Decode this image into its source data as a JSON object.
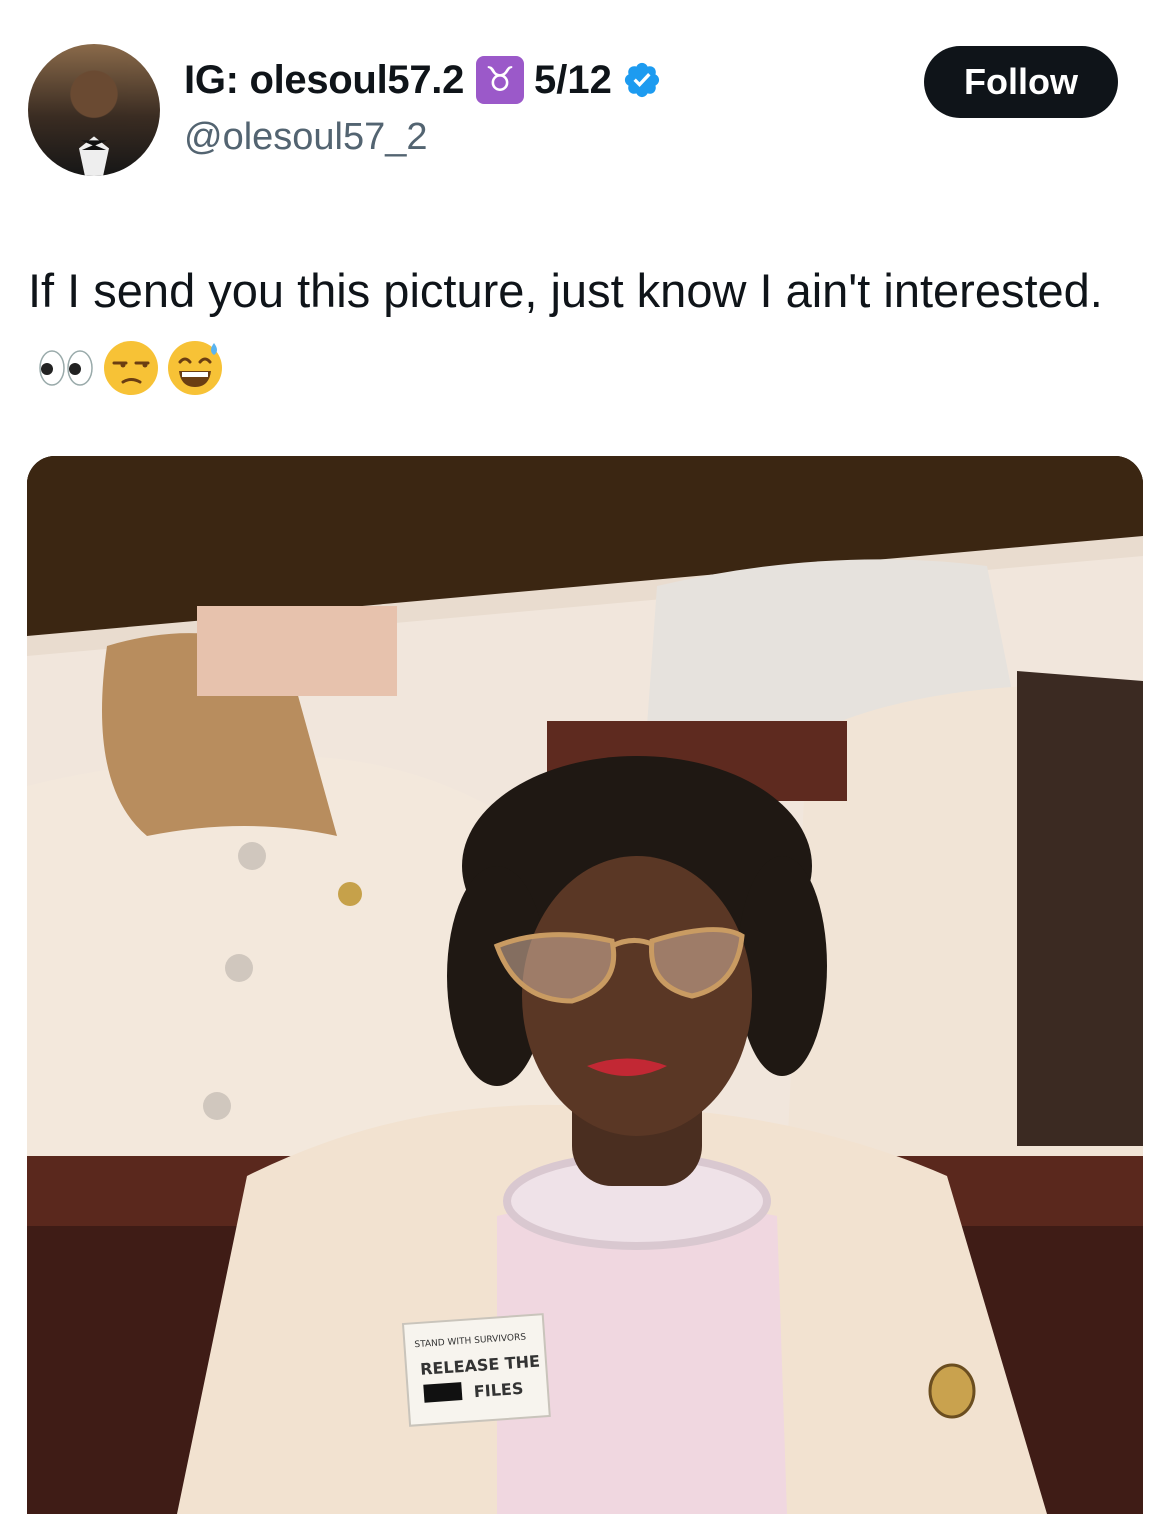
{
  "author": {
    "display_name": "IG: olesoul57.2",
    "zodiac_icon": "taurus-icon",
    "zodiac_glyph": "♉",
    "name_suffix": "5/12",
    "verified": true,
    "handle": "@olesoul57_2",
    "avatar_icon": "profile-photo"
  },
  "follow_button": {
    "label": "Follow"
  },
  "tweet": {
    "text": "If I send you this picture, just know I ain't interested.",
    "emojis": [
      "eyes-emoji",
      "unamused-face-emoji",
      "grinning-face-with-sweat-emoji"
    ]
  },
  "media": {
    "sign": {
      "line1": "STAND WITH SURVIVORS",
      "line2": "RELEASE THE",
      "line3": "FILES"
    }
  },
  "colors": {
    "follow_bg": "#0f1419",
    "verified_blue": "#1d9bf0",
    "handle_gray": "#536471",
    "taurus_purple": "#9b59c9"
  }
}
